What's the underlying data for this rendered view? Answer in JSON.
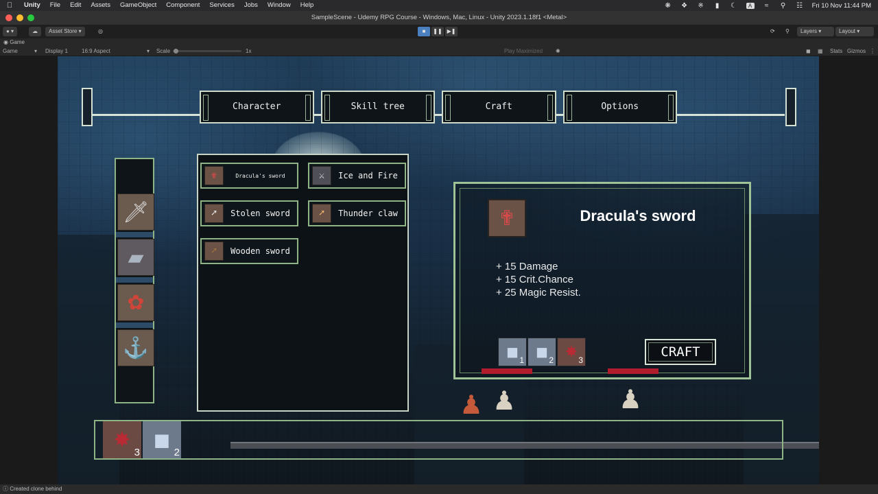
{
  "menubar": {
    "apple": "",
    "items": [
      "Unity",
      "File",
      "Edit",
      "Assets",
      "GameObject",
      "Component",
      "Services",
      "Jobs",
      "Window",
      "Help"
    ],
    "clock": "Fri 10 Nov  11:44 PM"
  },
  "window": {
    "title": "SampleScene - Udemy RPG Course - Windows, Mac, Linux - Unity 2023.1.18f1 <Metal>"
  },
  "toolbar": {
    "asset_store": "Asset Store",
    "layers": "Layers",
    "layout": "Layout"
  },
  "game_view": {
    "tab_label": "Game",
    "display_mode": "Game",
    "display": "Display 1",
    "aspect": "16:9 Aspect",
    "scale_label": "Scale",
    "scale_value": "1x",
    "play_mode": "Play Maximized",
    "stats": "Stats",
    "gizmos": "Gizmos"
  },
  "ui": {
    "tabs": [
      {
        "label": "Character"
      },
      {
        "label": "Skill tree"
      },
      {
        "label": "Craft"
      },
      {
        "label": "Options"
      }
    ],
    "craft_list": [
      {
        "label": "Dracula's sword",
        "icon": "dagger-icon"
      },
      {
        "label": "Ice and Fire",
        "icon": "crossed-swords-icon"
      },
      {
        "label": "Stolen sword",
        "icon": "sword-icon"
      },
      {
        "label": "Thunder claw",
        "icon": "claw-sword-icon"
      },
      {
        "label": "Wooden sword",
        "icon": "wooden-sword-icon"
      }
    ],
    "equipment": [
      "sword-icon",
      "armor-icon",
      "amulet-icon",
      "potion-icon"
    ],
    "detail": {
      "title": "Dracula's sword",
      "stats": [
        "+ 15 Damage",
        "+ 15 Crit.Chance",
        "+ 25 Magic Resist."
      ],
      "materials": [
        {
          "icon": "stone-icon",
          "count": "1"
        },
        {
          "icon": "stone-icon",
          "count": "2"
        },
        {
          "icon": "red-pelt-icon",
          "count": "3"
        }
      ],
      "craft_button": "CRAFT"
    },
    "inventory": [
      {
        "icon": "red-pelt-icon",
        "count": "3"
      },
      {
        "icon": "stone-icon",
        "count": "2"
      }
    ]
  },
  "status": {
    "message": "Created clone behind"
  },
  "colors": {
    "frame_green": "#8fb587",
    "health_red": "#b01c2c"
  }
}
